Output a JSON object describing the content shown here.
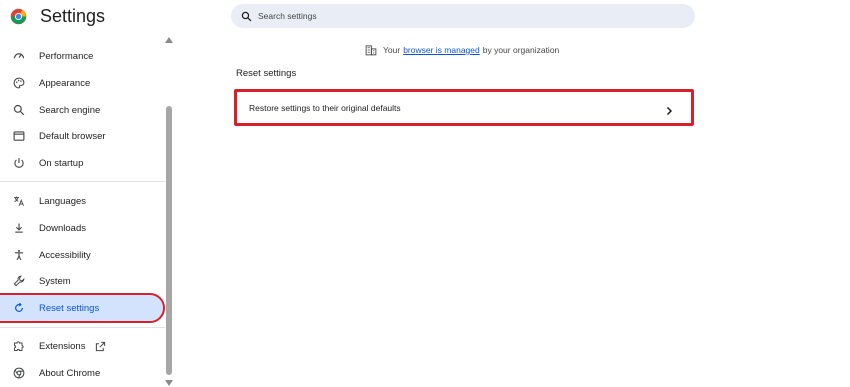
{
  "app": {
    "title": "Settings"
  },
  "search": {
    "placeholder": "Search settings"
  },
  "sidebar": {
    "items": [
      {
        "label": "Performance",
        "icon": "performance-icon"
      },
      {
        "label": "Appearance",
        "icon": "palette-icon"
      },
      {
        "label": "Search engine",
        "icon": "search-icon"
      },
      {
        "label": "Default browser",
        "icon": "browser-icon"
      },
      {
        "label": "On startup",
        "icon": "power-icon"
      },
      {
        "label": "Languages",
        "icon": "translate-icon"
      },
      {
        "label": "Downloads",
        "icon": "download-icon"
      },
      {
        "label": "Accessibility",
        "icon": "accessibility-icon"
      },
      {
        "label": "System",
        "icon": "wrench-icon"
      },
      {
        "label": "Reset settings",
        "icon": "reset-icon",
        "active": true
      },
      {
        "label": "Extensions",
        "icon": "extensions-icon"
      },
      {
        "label": "About Chrome",
        "icon": "chrome-icon"
      }
    ]
  },
  "main": {
    "managed": {
      "prefix": "Your",
      "link": "browser is managed",
      "suffix": "by your organization"
    },
    "section_title": "Reset settings",
    "reset_row_label": "Restore settings to their original defaults"
  },
  "colors": {
    "accent": "#0b57d0",
    "active_bg": "#d3e3fd",
    "highlight_border": "#d6202b",
    "search_bg": "#e9eef6"
  }
}
